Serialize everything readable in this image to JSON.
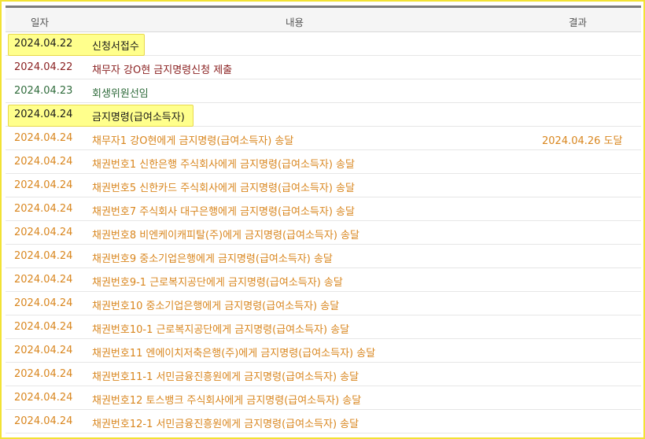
{
  "header": {
    "date": "일자",
    "content": "내용",
    "result": "결과"
  },
  "rows": [
    {
      "date": "2024.04.22",
      "content": "신청서접수",
      "result": ""
    },
    {
      "date": "2024.04.22",
      "content": "채무자 강O현 금지명령신청 제출",
      "result": ""
    },
    {
      "date": "2024.04.23",
      "content": "회생위원선임",
      "result": ""
    },
    {
      "date": "2024.04.24",
      "content": "금지명령(급여소득자)",
      "result": ""
    },
    {
      "date": "2024.04.24",
      "content": "채무자1 강O현에게 금지명령(급여소득자) 송달",
      "result": "2024.04.26 도달"
    },
    {
      "date": "2024.04.24",
      "content": "채권번호1 신한은행 주식회사에게 금지명령(급여소득자) 송달",
      "result": ""
    },
    {
      "date": "2024.04.24",
      "content": "채권번호5 신한카드 주식회사에게 금지명령(급여소득자) 송달",
      "result": ""
    },
    {
      "date": "2024.04.24",
      "content": "채권번호7 주식회사 대구은행에게 금지명령(급여소득자) 송달",
      "result": ""
    },
    {
      "date": "2024.04.24",
      "content": "채권번호8 비엔케이캐피탈(주)에게 금지명령(급여소득자) 송달",
      "result": ""
    },
    {
      "date": "2024.04.24",
      "content": "채권번호9 중소기업은행에게 금지명령(급여소득자) 송달",
      "result": ""
    },
    {
      "date": "2024.04.24",
      "content": "채권번호9-1 근로복지공단에게 금지명령(급여소득자) 송달",
      "result": ""
    },
    {
      "date": "2024.04.24",
      "content": "채권번호10 중소기업은행에게 금지명령(급여소득자) 송달",
      "result": ""
    },
    {
      "date": "2024.04.24",
      "content": "채권번호10-1 근로복지공단에게 금지명령(급여소득자) 송달",
      "result": ""
    },
    {
      "date": "2024.04.24",
      "content": "채권번호11 엔에이치저축은행(주)에게 금지명령(급여소득자) 송달",
      "result": ""
    },
    {
      "date": "2024.04.24",
      "content": "채권번호11-1 서민금융진흥원에게 금지명령(급여소득자) 송달",
      "result": ""
    },
    {
      "date": "2024.04.24",
      "content": "채권번호12 토스뱅크 주식회사에게 금지명령(급여소득자) 송달",
      "result": ""
    },
    {
      "date": "2024.04.24",
      "content": "채권번호12-1 서민금융진흥원에게 금지명령(급여소득자) 송달",
      "result": ""
    }
  ],
  "colors": {
    "highlight": "#ffff8c",
    "frame": "#f2e234",
    "black": "#222222",
    "maroon": "#8b2222",
    "green": "#2f6b3b",
    "orange": "#d9861e"
  }
}
